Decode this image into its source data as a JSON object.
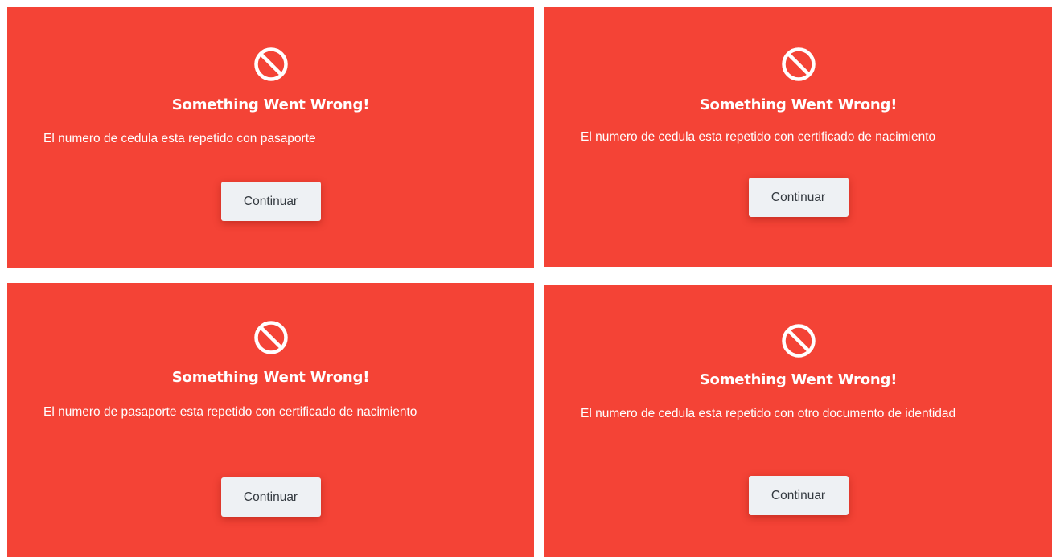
{
  "colors": {
    "panel_background": "#f44336",
    "text": "#ffffff",
    "button_background": "#eef1f4",
    "button_text": "#343a40"
  },
  "dialogs": [
    {
      "icon": "prohibited-icon",
      "title": "Something Went Wrong!",
      "message": "El numero de cedula esta repetido con pasaporte",
      "button_label": "Continuar"
    },
    {
      "icon": "prohibited-icon",
      "title": "Something Went Wrong!",
      "message": "El numero de cedula esta repetido con certificado de nacimiento",
      "button_label": "Continuar"
    },
    {
      "icon": "prohibited-icon",
      "title": "Something Went Wrong!",
      "message": "El numero de pasaporte esta repetido con certificado de nacimiento",
      "button_label": "Continuar"
    },
    {
      "icon": "prohibited-icon",
      "title": "Something Went Wrong!",
      "message": "El numero de cedula esta repetido con otro documento de identidad",
      "button_label": "Continuar"
    }
  ]
}
